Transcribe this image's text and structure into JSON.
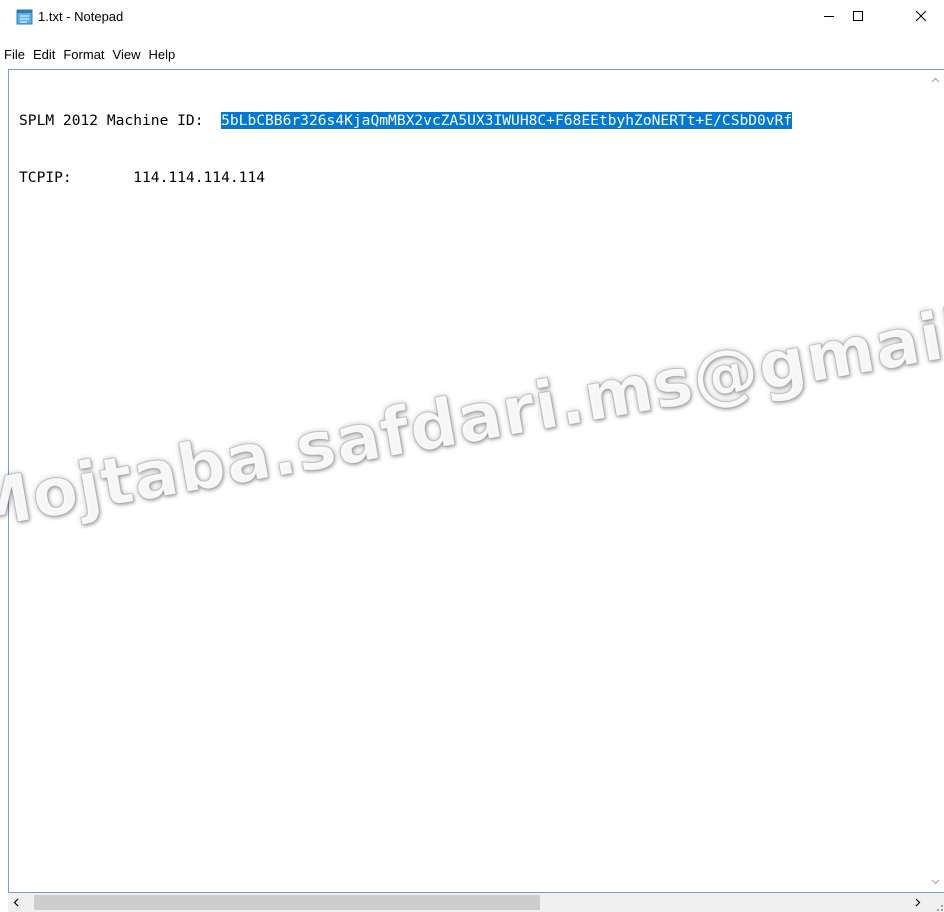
{
  "window": {
    "title": "1.txt - Notepad",
    "icon": "notepad-icon",
    "controls": {
      "minimize": "minimize-icon",
      "maximize": "maximize-icon",
      "close": "close-icon"
    }
  },
  "menu": {
    "items": [
      {
        "label": "File"
      },
      {
        "label": "Edit"
      },
      {
        "label": "Format"
      },
      {
        "label": "View"
      },
      {
        "label": "Help"
      }
    ]
  },
  "document": {
    "line1": {
      "prefix": "SPLM 2012 Machine ID:  ",
      "selected": "5bLbCBB6r326s4KjaQmMBX2vcZA5UX3IWUH8C+F68EEtbyhZoNERTt+E/CSbD0vRf"
    },
    "line2": {
      "text": "TCPIP:       114.114.114.114"
    }
  },
  "watermark": {
    "text": "Mojtaba.safdari.ms@gmail.co"
  },
  "colors": {
    "selection": "#0078d7",
    "border": "#7a9fc7",
    "scrollbar_track": "#f0f0f0",
    "scrollbar_thumb": "#cdcdcd"
  }
}
